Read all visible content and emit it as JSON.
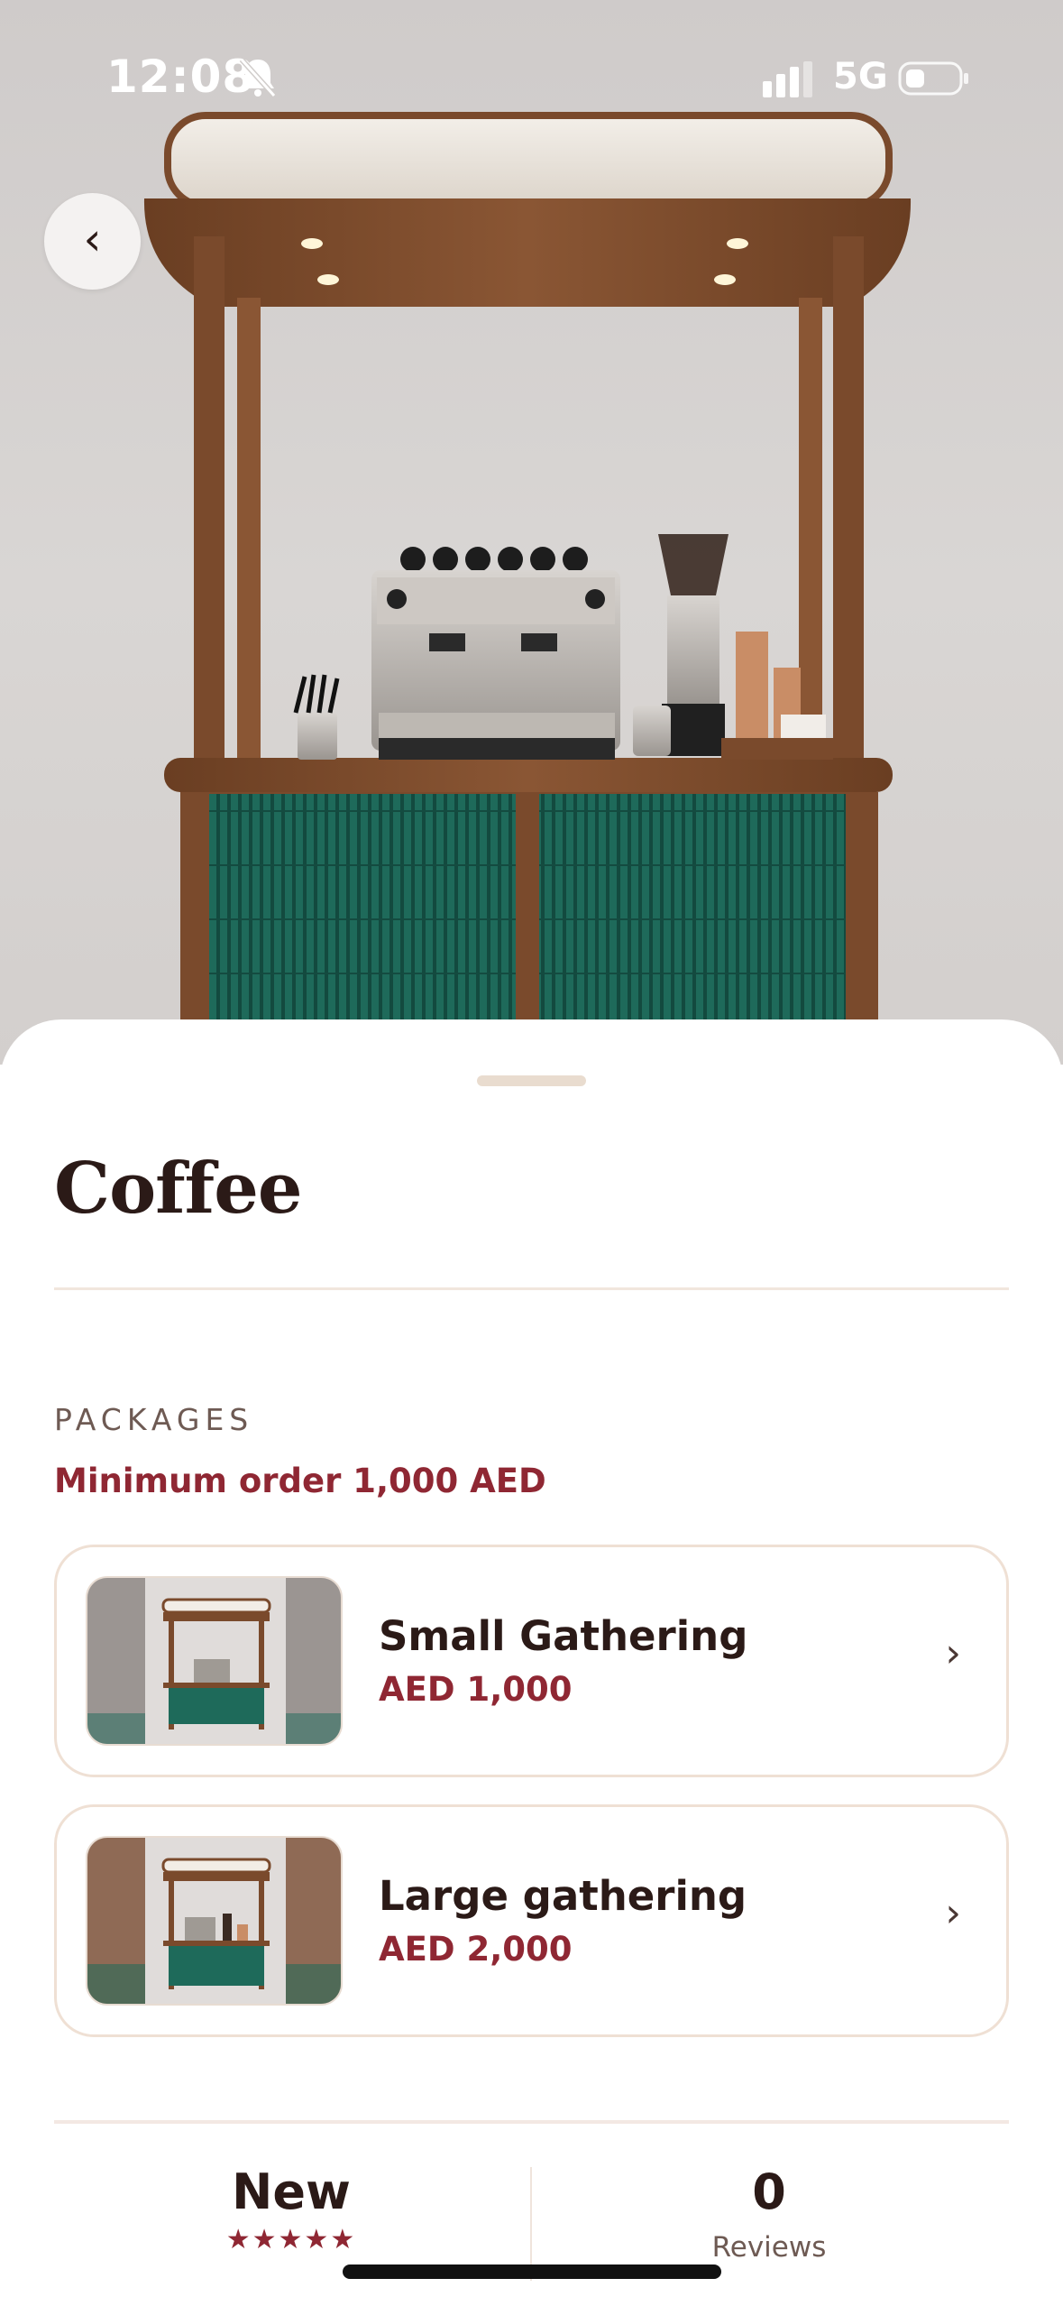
{
  "status_bar": {
    "time": "12:08",
    "network": "5G",
    "icons": [
      "bell-slash-icon",
      "signal-icon",
      "battery-icon"
    ]
  },
  "hero": {
    "image": "coffee-cart-photo",
    "back_icon": "‹"
  },
  "sheet": {
    "title": "Coffee",
    "section_label": "PACKAGES",
    "min_order": "Minimum order 1,000 AED",
    "packages": [
      {
        "name": "Small Gathering",
        "price": "AED 1,000",
        "chevron": "›"
      },
      {
        "name": "Large gathering",
        "price": "AED 2,000",
        "chevron": "›"
      }
    ],
    "stats": {
      "rating_value": "New",
      "stars": "★★★★★",
      "reviews_count": "0",
      "reviews_label": "Reviews"
    }
  },
  "colors": {
    "accent": "#8f2733",
    "text": "#2b1a17",
    "wood": "#7a4a2c",
    "teal": "#1f6b5c",
    "border": "#efe0d4"
  }
}
